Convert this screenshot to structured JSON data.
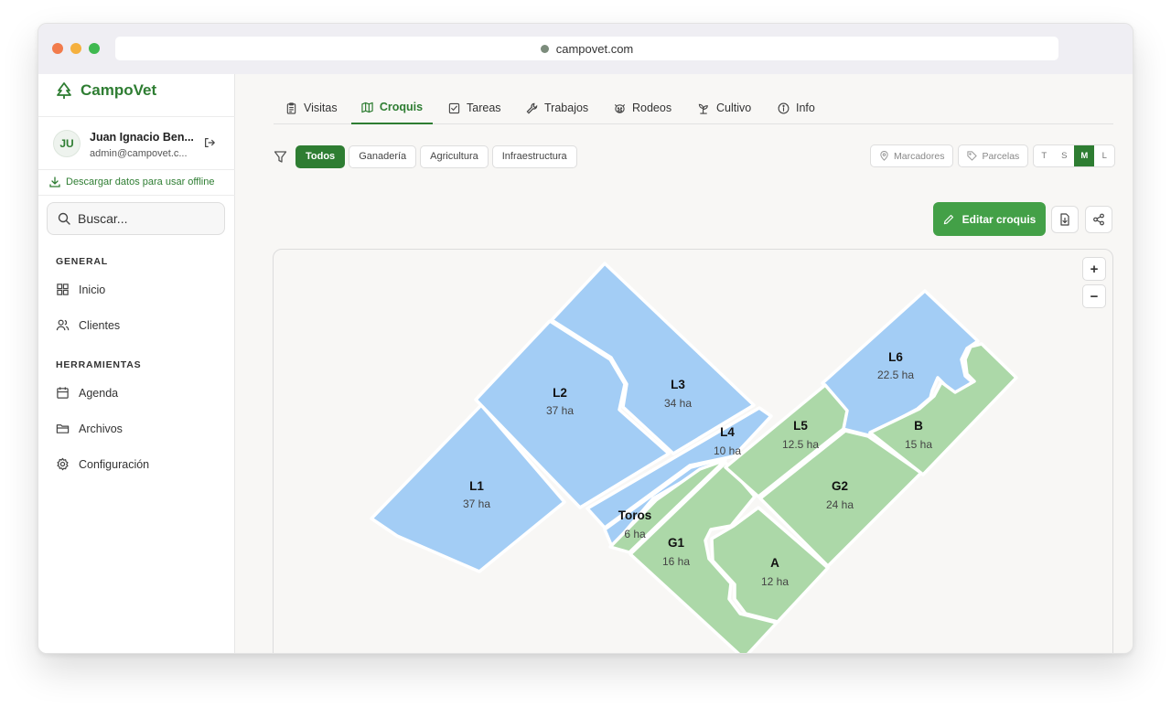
{
  "browser": {
    "url": "campovet.com",
    "dots": [
      "#f27b4b",
      "#f5b03e",
      "#3fb950"
    ]
  },
  "brand": {
    "name": "CampoVet",
    "color": "#2e7d32"
  },
  "user": {
    "initials": "JU",
    "name": "Juan Ignacio Ben...",
    "email": "admin@campovet.c..."
  },
  "offline_link": "Descargar datos para usar offline",
  "search": {
    "placeholder": "Buscar..."
  },
  "sections": {
    "general": "GENERAL",
    "tools": "HERRAMIENTAS"
  },
  "nav": {
    "inicio": "Inicio",
    "clientes": "Clientes",
    "agenda": "Agenda",
    "archivos": "Archivos",
    "configuracion": "Configuración"
  },
  "tabs": [
    {
      "label": "Visitas",
      "icon": "clipboard-icon"
    },
    {
      "label": "Croquis",
      "icon": "map-icon",
      "active": true
    },
    {
      "label": "Tareas",
      "icon": "checkbox-icon"
    },
    {
      "label": "Trabajos",
      "icon": "wrench-icon"
    },
    {
      "label": "Rodeos",
      "icon": "cow-icon"
    },
    {
      "label": "Cultivo",
      "icon": "sprout-icon"
    },
    {
      "label": "Info",
      "icon": "info-icon"
    }
  ],
  "filters": {
    "todos": "Todos",
    "ganaderia": "Ganadería",
    "agricultura": "Agricultura",
    "infraestructura": "Infraestructura",
    "active": "Todos"
  },
  "toggles": {
    "markers": "Marcadores",
    "parcels": "Parcelas"
  },
  "label_sizes": {
    "t": "T",
    "s": "S",
    "m": "M",
    "l": "L",
    "selected": "M"
  },
  "actions": {
    "edit": "Editar croquis"
  },
  "map": {
    "zoom_in": "+",
    "zoom_out": "−",
    "colors": {
      "livestock": "#a3cdf5",
      "crop": "#acd8a8"
    },
    "plots": {
      "L1": {
        "name": "L1",
        "area": "37 ha"
      },
      "L2": {
        "name": "L2",
        "area": "37 ha"
      },
      "L3": {
        "name": "L3",
        "area": "34 ha"
      },
      "L4": {
        "name": "L4",
        "area": "10 ha"
      },
      "L5": {
        "name": "L5",
        "area": "12.5 ha"
      },
      "L6": {
        "name": "L6",
        "area": "22.5 ha"
      },
      "B": {
        "name": "B",
        "area": "15 ha"
      },
      "G2": {
        "name": "G2",
        "area": "24 ha"
      },
      "G1": {
        "name": "G1",
        "area": "16 ha"
      },
      "A": {
        "name": "A",
        "area": "12 ha"
      },
      "Toros": {
        "name": "Toros",
        "area": "6 ha"
      }
    }
  }
}
